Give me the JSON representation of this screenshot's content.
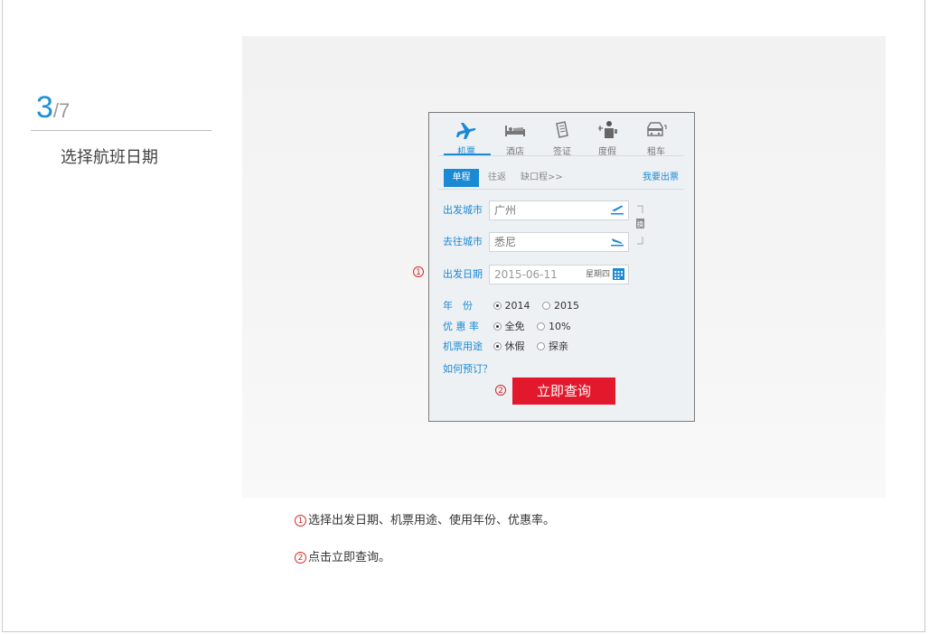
{
  "step": {
    "current": "3",
    "total": "/7",
    "title": "选择航班日期"
  },
  "widget": {
    "tabs": [
      {
        "label": "机票",
        "icon": "plane-icon",
        "active": true
      },
      {
        "label": "酒店",
        "icon": "bed-icon",
        "active": false
      },
      {
        "label": "签证",
        "icon": "passport-icon",
        "active": false
      },
      {
        "label": "度假",
        "icon": "vacation-icon",
        "active": false
      },
      {
        "label": "租车",
        "icon": "car-icon",
        "active": false
      }
    ],
    "trip_types": {
      "oneway": "单程",
      "roundtrip": "往返",
      "multi": "缺口程>>",
      "issue": "我要出票"
    },
    "from": {
      "label": "出发城市",
      "value": "广州"
    },
    "to": {
      "label": "去往城市",
      "value": "悉尼"
    },
    "swap_label": "换",
    "date": {
      "label": "出发日期",
      "value": "2015-06-11",
      "weekday": "星期四"
    },
    "year": {
      "label": "年　份",
      "options": [
        "2014",
        "2015"
      ],
      "selected": "2014"
    },
    "discount": {
      "label": "优 惠 率",
      "options": [
        "全免",
        "10%"
      ],
      "selected": "全免"
    },
    "purpose": {
      "label": "机票用途",
      "options": [
        "休假",
        "探亲"
      ],
      "selected": "休假"
    },
    "how_to": "如何预订？",
    "submit": "立即查询",
    "accent": "#1a8ad4",
    "submit_color": "#e3182d"
  },
  "markers": {
    "one": "1",
    "two": "2"
  },
  "notes": [
    "选择出发日期、机票用途、使用年份、优惠率。",
    "点击立即查询。"
  ]
}
